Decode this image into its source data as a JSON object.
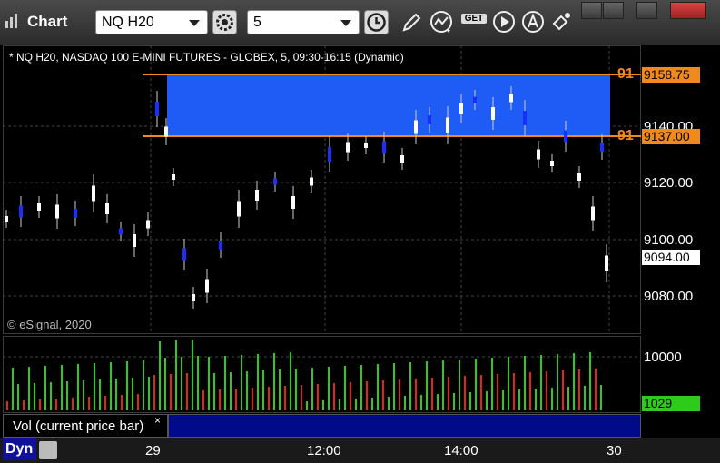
{
  "window": {
    "title": "Chart"
  },
  "toolbar": {
    "symbol": "NQ H20",
    "interval": "5",
    "get_label": "GET"
  },
  "chart": {
    "description": "* NQ H20, NASDAQ 100 E-MINI FUTURES - GLOBEX, 5, 09:30-16:15 (Dynamic)",
    "copyright": "© eSignal, 2020",
    "price_axis": [
      "9140.00",
      "9120.00",
      "9100.00",
      "9080.00"
    ],
    "upper_line_price": "9158.75",
    "lower_line_price": "9137.00",
    "current_price": "9094.00",
    "line_label_upper": "91",
    "line_label_lower": "91",
    "range_fill_color": "#1e5cf5",
    "line_color": "#f08a1c"
  },
  "volume": {
    "axis": [
      "10000"
    ],
    "current_value": "1029",
    "current_color": "#2ecc1a",
    "study_label": "Vol (current price bar)",
    "close_glyph": "×"
  },
  "time_axis": {
    "mode": "Dyn",
    "labels": [
      "29",
      "12:00",
      "14:00",
      "30"
    ]
  }
}
